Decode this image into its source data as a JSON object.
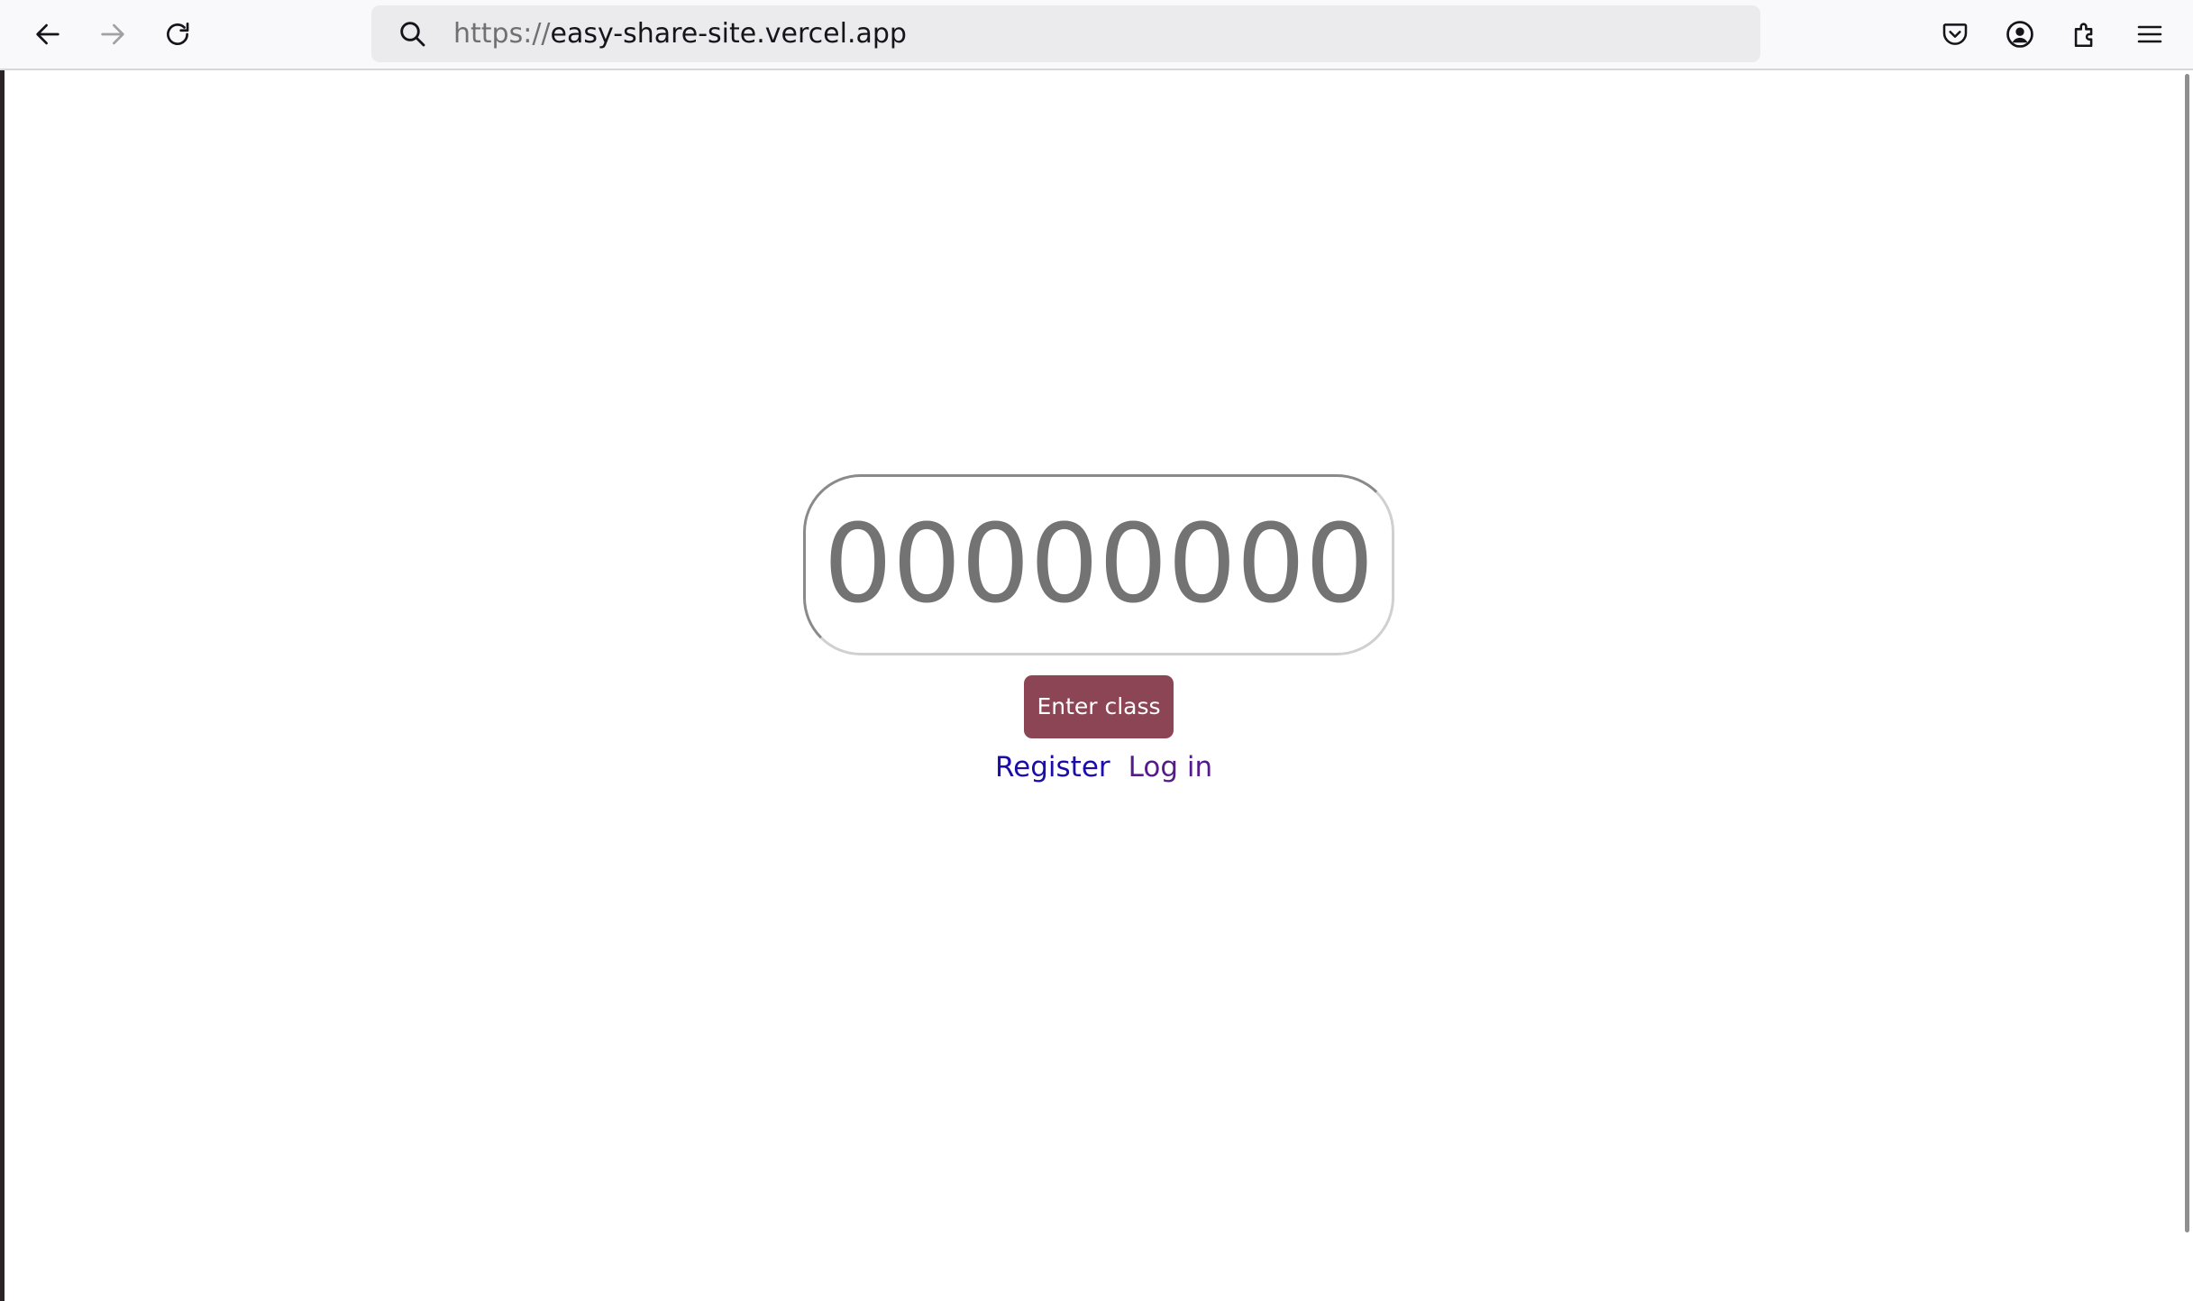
{
  "browser": {
    "url_scheme": "https://",
    "url_host": "easy-share-site.vercel.app",
    "icons": {
      "back": "arrow-left-icon",
      "forward": "arrow-right-icon",
      "reload": "reload-icon",
      "search": "search-icon",
      "pocket": "pocket-icon",
      "account": "account-icon",
      "extensions": "puzzle-icon",
      "menu": "hamburger-menu-icon"
    }
  },
  "page": {
    "class_code_placeholder": "00000000",
    "enter_button_label": "Enter class",
    "register_link": "Register",
    "login_link": "Log in"
  },
  "colors": {
    "enter_button_bg": "#8c4554",
    "register_link": "#1a0dab",
    "login_link": "#551a8b"
  }
}
